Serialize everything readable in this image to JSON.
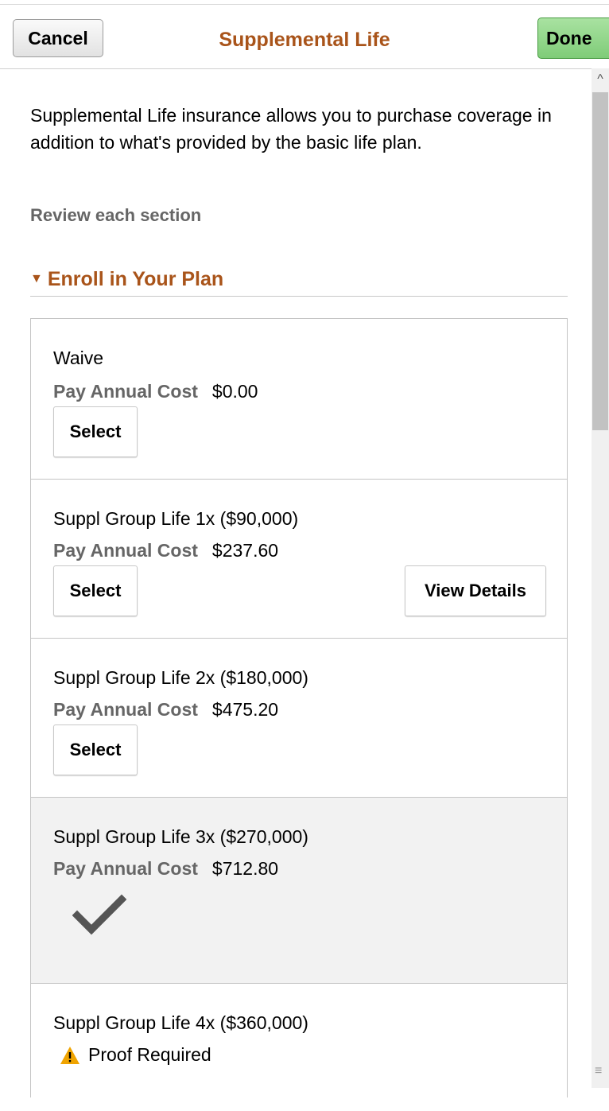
{
  "header": {
    "cancel_label": "Cancel",
    "title": "Supplemental Life",
    "done_label": "Done"
  },
  "intro": "Supplemental Life insurance allows you to purchase coverage in addition to what's provided by the basic life plan.",
  "review_label": "Review each section",
  "section": {
    "title": "Enroll in Your Plan",
    "cost_label": "Pay Annual Cost",
    "plans": [
      {
        "name": "Waive",
        "cost": "$0.00",
        "select_label": "Select"
      },
      {
        "name": "Suppl Group Life 1x  ($90,000)",
        "cost": "$237.60",
        "select_label": "Select",
        "details_label": "View Details"
      },
      {
        "name": "Suppl Group Life 2x  ($180,000)",
        "cost": "$475.20",
        "select_label": "Select"
      },
      {
        "name": "Suppl Group Life 3x  ($270,000)",
        "cost": "$712.80",
        "selected": true
      },
      {
        "name": "Suppl Group Life 4x  ($360,000)",
        "proof_label": "Proof Required"
      }
    ]
  },
  "colors": {
    "accent": "#a9541a",
    "done_green": "#7fcc78",
    "selected_bg": "#f2f2f2"
  },
  "icons": [
    "chevron-down-icon",
    "checkmark-icon",
    "warning-icon"
  ]
}
